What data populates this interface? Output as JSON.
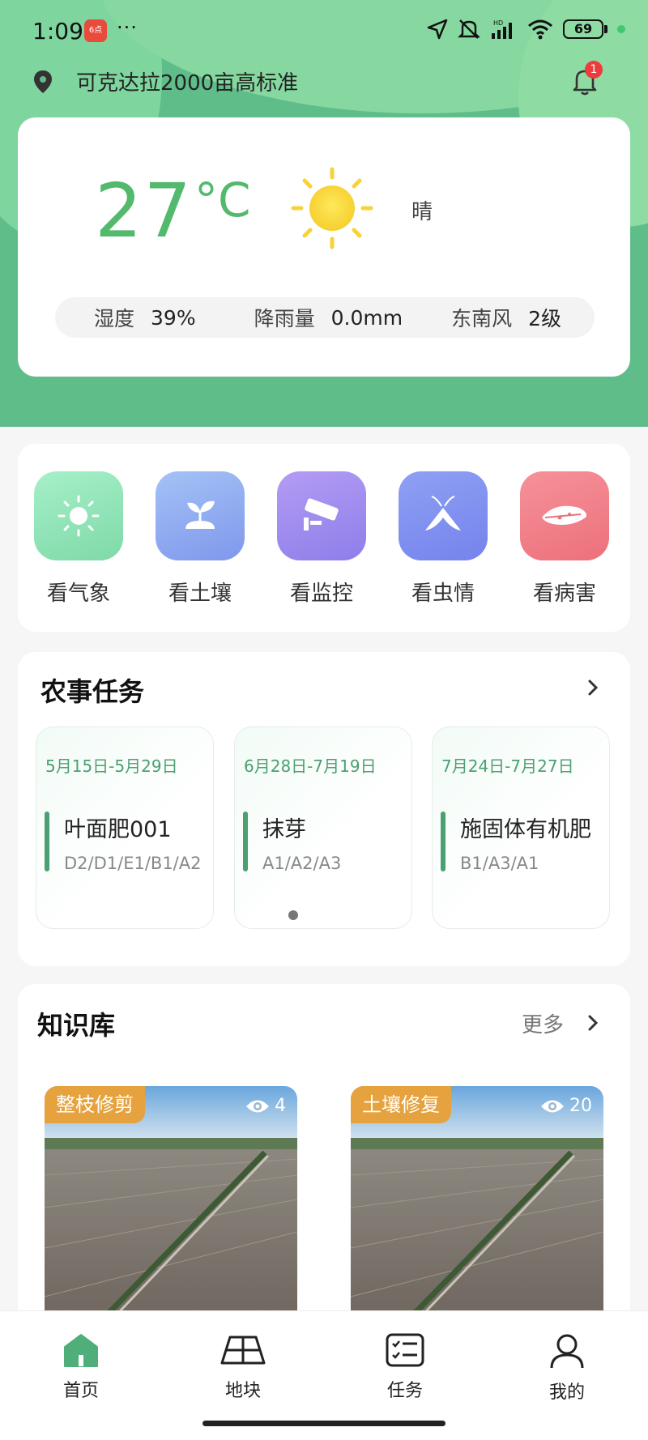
{
  "status_bar": {
    "time": "1:09",
    "app_badge": "6点",
    "more_dots": "···",
    "battery": "69",
    "network_label": "HD"
  },
  "location": {
    "name": "可克达拉2000亩高标准"
  },
  "notifications": {
    "count": "1"
  },
  "weather": {
    "temperature": "27",
    "unit": "°C",
    "condition": "晴",
    "humidity_label": "湿度",
    "humidity_value": "39%",
    "rainfall_label": "降雨量",
    "rainfall_value": "0.0mm",
    "wind_label": "东南风",
    "wind_value": "2级"
  },
  "quick_access": [
    {
      "label": "看气象",
      "icon": "sun-icon",
      "color": "#8fe3b6"
    },
    {
      "label": "看土壤",
      "icon": "sprout-icon",
      "color": "#8ea9f0"
    },
    {
      "label": "看监控",
      "icon": "camera-icon",
      "color": "#9c8cf0"
    },
    {
      "label": "看虫情",
      "icon": "moth-icon",
      "color": "#7f8ff0"
    },
    {
      "label": "看病害",
      "icon": "leaf-icon",
      "color": "#ee7f86"
    }
  ],
  "tasks": {
    "title": "农事任务",
    "items": [
      {
        "date": "5月15日-5月29日",
        "name": "叶面肥001",
        "plots": "D2/D1/E1/B1/A2"
      },
      {
        "date": "6月28日-7月19日",
        "name": "抹芽",
        "plots": "A1/A2/A3"
      },
      {
        "date": "7月24日-7月27日",
        "name": "施固体有机肥",
        "plots": "B1/A3/A1"
      }
    ]
  },
  "knowledge": {
    "title": "知识库",
    "more_label": "更多",
    "items": [
      {
        "tag": "整枝修剪",
        "views": "4"
      },
      {
        "tag": "土壤修复",
        "views": "20"
      }
    ]
  },
  "bottom_nav": [
    {
      "label": "首页",
      "icon": "home-icon",
      "active": true
    },
    {
      "label": "地块",
      "icon": "field-icon",
      "active": false
    },
    {
      "label": "任务",
      "icon": "task-list-icon",
      "active": false
    },
    {
      "label": "我的",
      "icon": "user-icon",
      "active": false
    }
  ],
  "colors": {
    "primary_green": "#52b96d",
    "header_green": "#5fbd8a",
    "tag_orange": "#e5a23e",
    "badge_red": "#ee3b3b"
  }
}
